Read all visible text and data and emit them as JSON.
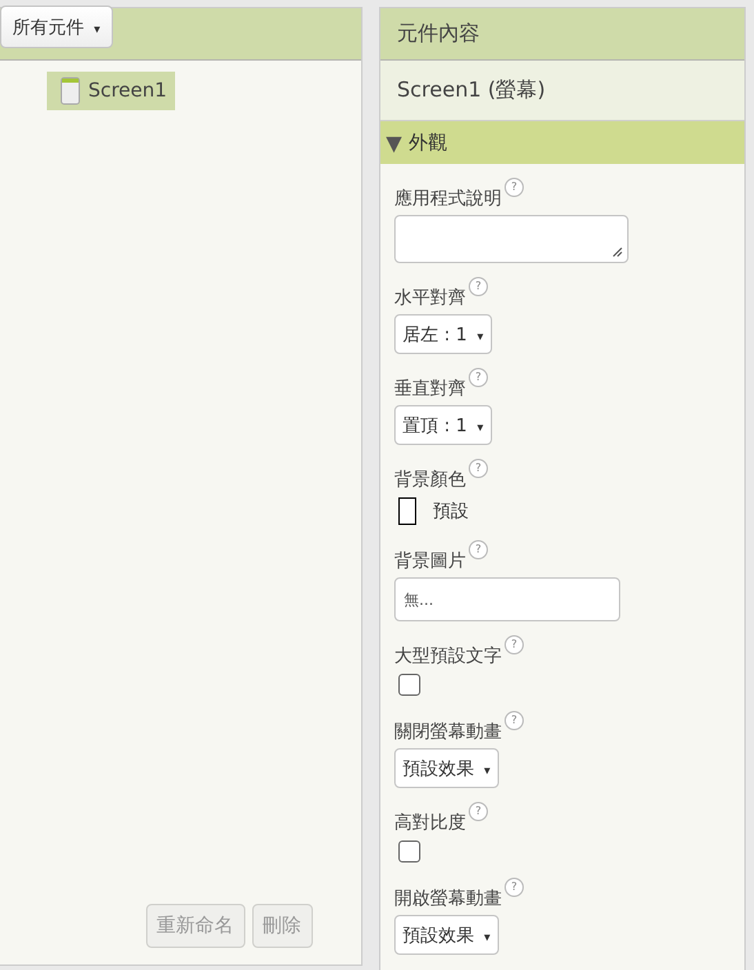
{
  "components_panel": {
    "filter": {
      "label": "所有元件",
      "caret": "▾"
    },
    "tree": [
      {
        "label": "Screen1",
        "selected": true
      }
    ],
    "buttons": [
      {
        "label": "重新命名",
        "disabled": true
      },
      {
        "label": "刪除",
        "disabled": true
      }
    ]
  },
  "properties_panel": {
    "title": "元件內容",
    "component": "Screen1 (螢幕)",
    "section": {
      "label": "外觀",
      "expanded": true,
      "toggle": "▼"
    },
    "properties": [
      {
        "kind": "textarea",
        "label": "應用程式說明",
        "help": "?"
      },
      {
        "kind": "dropdown",
        "label": "水平對齊",
        "help": "?",
        "value": "居左 : 1",
        "caret": "▾"
      },
      {
        "kind": "dropdown",
        "label": "垂直對齊",
        "help": "?",
        "value": "置頂 : 1",
        "caret": "▾"
      },
      {
        "kind": "color",
        "label": "背景顏色",
        "help": "?",
        "value": "預設",
        "color": "#ffffff"
      },
      {
        "kind": "textbox",
        "label": "背景圖片",
        "help": "?",
        "value": "無..."
      },
      {
        "kind": "checkbox",
        "label": "大型預設文字",
        "help": "?",
        "checked": false
      },
      {
        "kind": "dropdown",
        "label": "關閉螢幕動畫",
        "help": "?",
        "value": "預設效果",
        "caret": "▾"
      },
      {
        "kind": "checkbox",
        "label": "高對比度",
        "help": "?",
        "checked": false
      },
      {
        "kind": "dropdown",
        "label": "開啟螢幕動畫",
        "help": "?",
        "value": "預設效果",
        "caret": "▾"
      }
    ]
  }
}
